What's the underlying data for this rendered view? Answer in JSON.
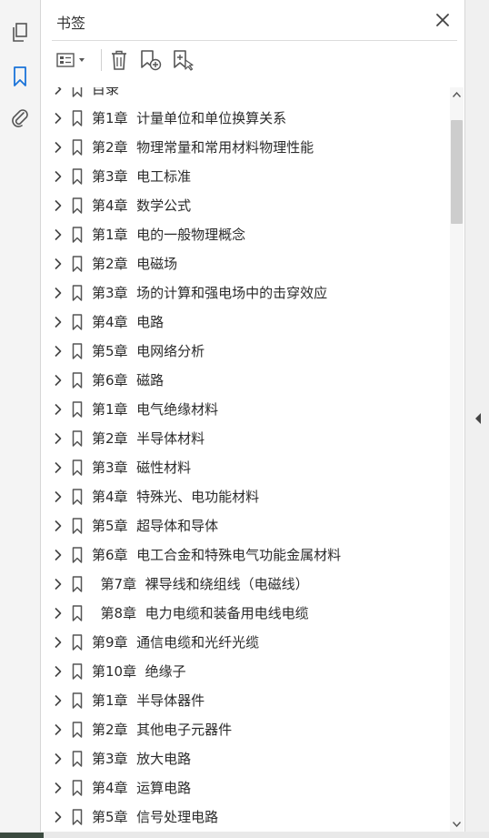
{
  "panel": {
    "title": "书签",
    "close_label": "×"
  },
  "left_rail": {
    "icons": [
      "pages-icon",
      "bookmark-icon",
      "attachment-icon"
    ]
  },
  "toolbar": {
    "icons": [
      "options-menu-icon",
      "delete-bookmark-icon",
      "new-bookmark-icon",
      "new-bookmark-from-structure-icon"
    ]
  },
  "bookmarks": [
    {
      "label": "目录"
    },
    {
      "label": "第1章  计量单位和单位换算关系"
    },
    {
      "label": "第2章  物理常量和常用材料物理性能"
    },
    {
      "label": "第3章  电工标准"
    },
    {
      "label": "第4章  数学公式"
    },
    {
      "label": "第1章  电的一般物理概念"
    },
    {
      "label": "第2章  电磁场"
    },
    {
      "label": "第3章  场的计算和强电场中的击穿效应"
    },
    {
      "label": "第4章  电路"
    },
    {
      "label": "第5章  电网络分析"
    },
    {
      "label": "第6章  磁路"
    },
    {
      "label": "第1章  电气绝缘材料"
    },
    {
      "label": "第2章  半导体材料"
    },
    {
      "label": "第3章  磁性材料"
    },
    {
      "label": "第4章  特殊光、电功能材料"
    },
    {
      "label": "第5章  超导体和导体"
    },
    {
      "label": "第6章  电工合金和特殊电气功能金属材料"
    },
    {
      "label": "  第7章  裸导线和绕组线（电磁线）"
    },
    {
      "label": "  第8章  电力电缆和装备用电线电缆"
    },
    {
      "label": "第9章  通信电缆和光纤光缆"
    },
    {
      "label": "第10章  绝缘子"
    },
    {
      "label": "第1章  半导体器件"
    },
    {
      "label": "第2章  其他电子元器件"
    },
    {
      "label": "第3章  放大电路"
    },
    {
      "label": "第4章  运算电路"
    },
    {
      "label": "第5章  信号处理电路"
    }
  ],
  "colors": {
    "icon_blue": "#1a73d9",
    "icon_gray": "#555555",
    "text": "#2b2b2b"
  }
}
